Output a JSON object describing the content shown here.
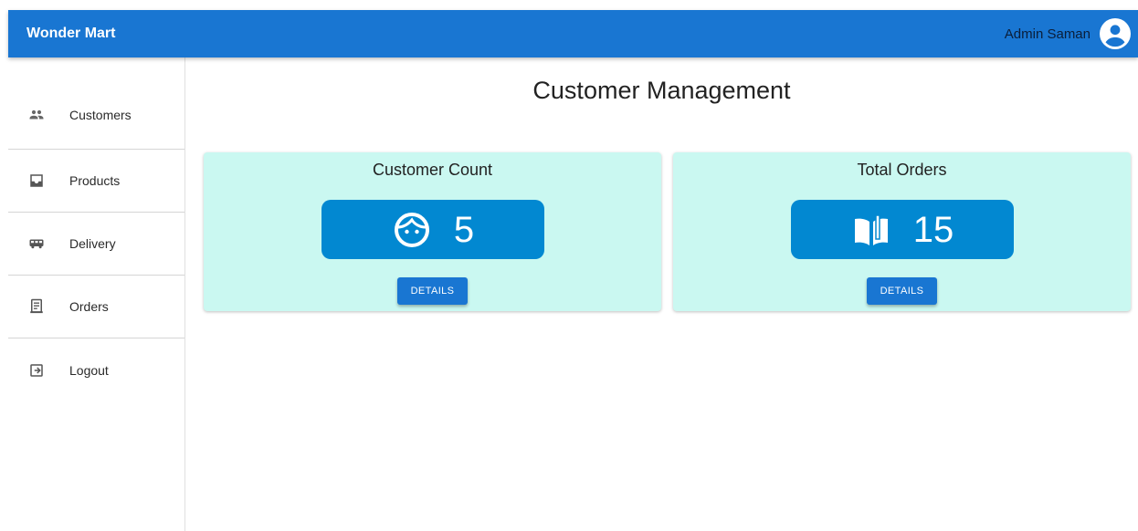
{
  "app": {
    "brand": "Wonder Mart"
  },
  "user": {
    "name": "Admin Saman",
    "avatar_icon": "account-circle-icon"
  },
  "sidebar": {
    "items": [
      {
        "label": "Customers",
        "icon": "people-icon"
      },
      {
        "label": "Products",
        "icon": "inbox-icon"
      },
      {
        "label": "Delivery",
        "icon": "bus-icon"
      },
      {
        "label": "Orders",
        "icon": "receipt-icon"
      },
      {
        "label": "Logout",
        "icon": "logout-icon"
      }
    ]
  },
  "main": {
    "title": "Customer Management",
    "cards": [
      {
        "title": "Customer Count",
        "value": "5",
        "icon": "face-icon",
        "button": "Details"
      },
      {
        "title": "Total Orders",
        "value": "15",
        "icon": "book-icon",
        "button": "Details"
      }
    ]
  },
  "colors": {
    "appbar": "#1976d2",
    "card_bg": "#caf8f1",
    "stat_box": "#0288d1",
    "button": "#1976d2"
  }
}
